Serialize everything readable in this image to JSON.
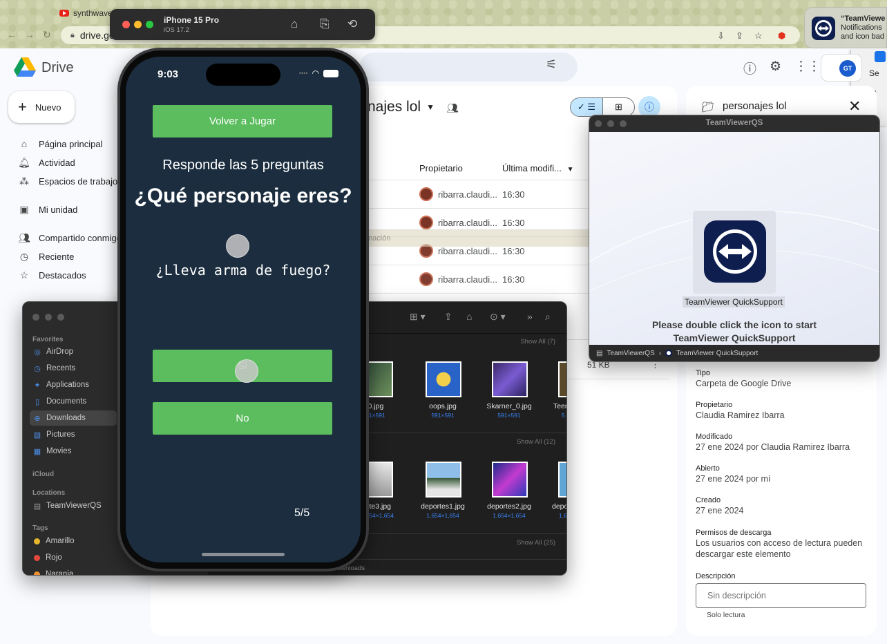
{
  "browser": {
    "tab_title": "synthwave",
    "url": "drive.go"
  },
  "notification": {
    "title": "“TeamViewe",
    "line1": "Notifications",
    "line2": "and icon bad"
  },
  "extensions_panel": {
    "item1": "Se",
    "item2": "C"
  },
  "drive": {
    "app_name": "Drive",
    "new_button": "Nuevo",
    "account_initials": "GT",
    "sidebar": [
      {
        "label": "Página principal",
        "icon": "home-icon"
      },
      {
        "label": "Actividad",
        "icon": "bell-icon"
      },
      {
        "label": "Espacios de trabajo",
        "icon": "workspaces-icon"
      },
      {
        "label": "Mi unidad",
        "icon": "drive-icon"
      },
      {
        "label": "Compartido conmigo",
        "icon": "shared-icon"
      },
      {
        "label": "Reciente",
        "icon": "clock-icon"
      },
      {
        "label": "Destacados",
        "icon": "star-icon"
      }
    ],
    "folder_title": "najes lol",
    "columns": {
      "owner": "Propietario",
      "modified": "Última modifi..."
    },
    "rows": [
      {
        "owner": "ribarra.claudi...",
        "time": "16:30"
      },
      {
        "owner": "ribarra.claudi...",
        "time": "16:30"
      },
      {
        "owner": "ribarra.claudi...",
        "time": "16:30"
      },
      {
        "owner": "ribarra.claudi...",
        "time": "16:30"
      }
    ],
    "size_visible": "51 KB"
  },
  "details": {
    "title": "personajes lol",
    "fields": [
      {
        "label": "Tipo",
        "value": "Carpeta de Google Drive"
      },
      {
        "label": "Propietario",
        "value": "Claudia Ramirez Ibarra"
      },
      {
        "label": "Modificado",
        "value": "27 ene 2024 por Claudia Ramirez Ibarra"
      },
      {
        "label": "Abierto",
        "value": "27 ene 2024 por mí"
      },
      {
        "label": "Creado",
        "value": "27 ene 2024"
      },
      {
        "label": "Permisos de descarga",
        "value": "Los usuarios con acceso de lectura pueden descargar este elemento"
      }
    ],
    "description_label": "Descripción",
    "description_placeholder": "Sin descripción",
    "description_note": "Solo lectura"
  },
  "teamviewer": {
    "window_title": "TeamViewerQS",
    "app_label": "TeamViewer QuickSupport",
    "message_line1": "Please double click the icon to start",
    "message_line2": "TeamViewer QuickSupport",
    "path_parent": "TeamViewerQS",
    "path_child": "TeamViewer QuickSupport"
  },
  "info_dialog": {
    "title": "Información"
  },
  "finder": {
    "sidebar": {
      "favorites_header": "Favorites",
      "favorites": [
        {
          "label": "AirDrop",
          "icon": "airdrop-icon"
        },
        {
          "label": "Recents",
          "icon": "clock-icon"
        },
        {
          "label": "Applications",
          "icon": "applications-icon"
        },
        {
          "label": "Documents",
          "icon": "document-icon"
        },
        {
          "label": "Downloads",
          "icon": "download-icon",
          "selected": true
        },
        {
          "label": "Pictures",
          "icon": "pictures-icon"
        },
        {
          "label": "Movies",
          "icon": "movies-icon"
        }
      ],
      "icloud_header": "iCloud",
      "locations_header": "Locations",
      "locations": [
        {
          "label": "TeamViewerQS",
          "icon": "disk-icon"
        }
      ],
      "tags_header": "Tags",
      "tags": [
        {
          "label": "Amarillo",
          "color": "#e6b62b"
        },
        {
          "label": "Rojo",
          "color": "#e5483d"
        },
        {
          "label": "Naranja",
          "color": "#f0902e"
        }
      ]
    },
    "sections": [
      {
        "show_all": "Show All (7)",
        "files": [
          {
            "name": "_0.jpg",
            "dim": "591×591"
          },
          {
            "name": "oops.jpg",
            "dim": "591×591"
          },
          {
            "name": "Skarner_0.jpg",
            "dim": "591×591"
          },
          {
            "name": "Teem",
            "dim": "5"
          }
        ]
      },
      {
        "show_all": "Show All (12)",
        "files": [
          {
            "name": "te3.jpg",
            "dim": "54×1,654"
          },
          {
            "name": "deportes1.jpg",
            "dim": "1,654×1,654"
          },
          {
            "name": "deportes2.jpg",
            "dim": "1,654×1,654"
          },
          {
            "name": "depo",
            "dim": "1,6"
          }
        ]
      },
      {
        "show_all": "Show All (25)",
        "files": []
      }
    ],
    "path_text": "Downloads"
  },
  "simulator": {
    "device": "iPhone 15 Pro",
    "os": "iOS 17.2"
  },
  "phone": {
    "time": "9:03",
    "replay_button": "Volver a Jugar",
    "subtitle": "Responde las 5 preguntas",
    "title": "¿Qué personaje eres?",
    "question": "¿Lleva arma de fuego?",
    "yes_button": "Sí",
    "no_button": "No",
    "progress": "5/5"
  },
  "colors": {
    "game_bg": "#1b2d3e",
    "game_button": "#5cbd5f",
    "drive_selected": "#c2e7ff",
    "teamviewer_blue": "#0e1f4f"
  }
}
